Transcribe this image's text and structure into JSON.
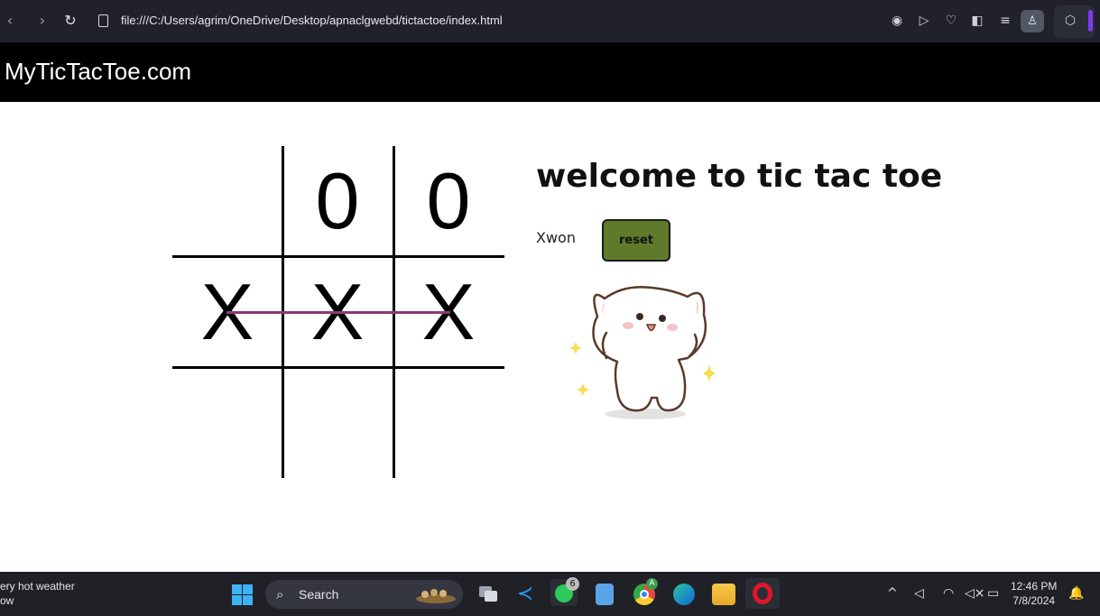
{
  "browser": {
    "url": "file:///C:/Users/agrim/OneDrive/Desktop/apnaclgwebd/tictactoe/index.html",
    "icons": [
      "back-icon",
      "forward-icon",
      "reload-icon",
      "file-icon",
      "camera-icon",
      "send-icon",
      "heart-icon",
      "contrast-icon",
      "menu-icon",
      "profile-icon",
      "cube-icon"
    ]
  },
  "site": {
    "title": "MyTicTacToe.com"
  },
  "game": {
    "board": [
      "",
      "0",
      "0",
      "X",
      "X",
      "X",
      "",
      "",
      ""
    ],
    "heading": "welcome to tic tac toe",
    "winner_text": "Xwon",
    "reset_label": "reset",
    "winning_line_color": "#8a3a7a",
    "reset_color": "#5f7a2a"
  },
  "taskbar": {
    "weather_line1": "ery hot weather",
    "weather_line2": "ow",
    "search_label": "Search",
    "whatsapp_badge": "6",
    "chrome_badge": "A",
    "time": "12:46 PM",
    "date": "7/8/2024"
  }
}
